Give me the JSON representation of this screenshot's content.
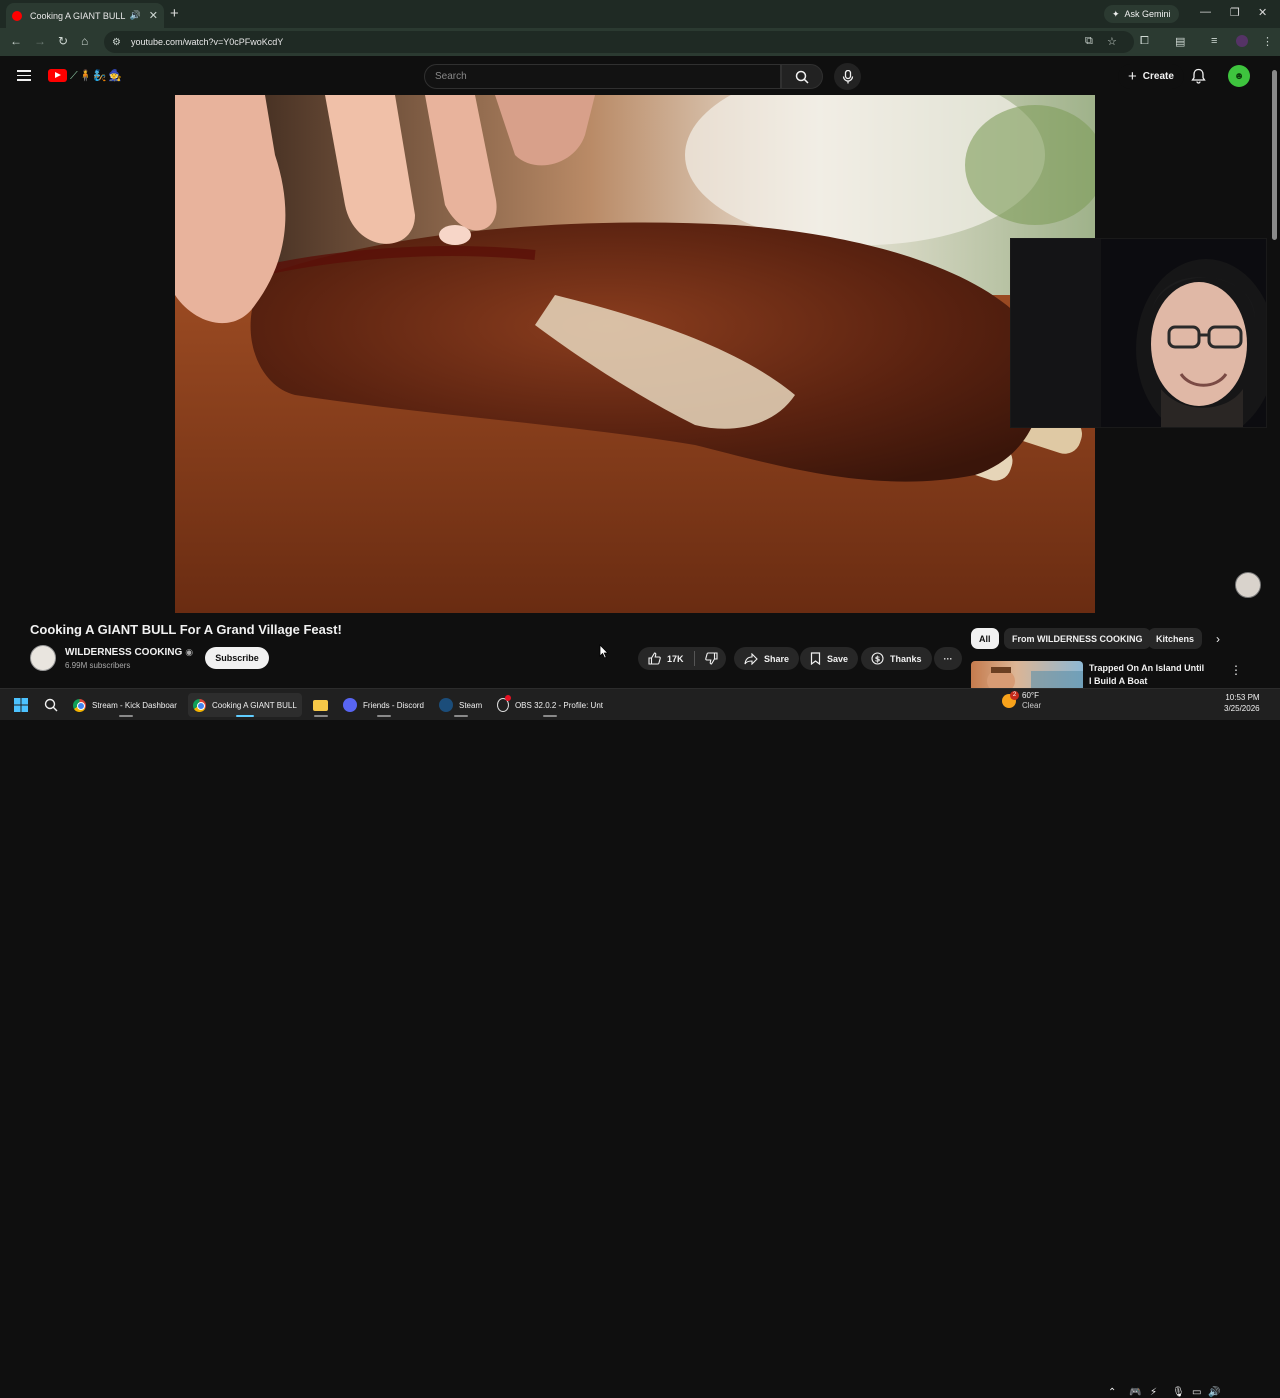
{
  "browser": {
    "tab_title": "Cooking A GIANT BULL For",
    "new_tab_symbol": "+",
    "ask_gemini": "Ask Gemini",
    "url": "youtube.com/watch?v=Y0cPFwoKcdY"
  },
  "youtube": {
    "doodle_text": "⟋🧍🧞🧙",
    "search_placeholder": "Search",
    "create_label": "Create",
    "avatar_glyph": "☻"
  },
  "video": {
    "title": "Cooking A GIANT BULL For A Grand Village Feast!",
    "channel_name": "WILDERNESS COOKING",
    "subscribers": "6.99M subscribers",
    "subscribe_label": "Subscribe",
    "like_count": "17K",
    "share_label": "Share",
    "save_label": "Save",
    "thanks_label": "Thanks",
    "more_label": "···"
  },
  "sidebar": {
    "chips": [
      "All",
      "From WILDERNESS COOKING",
      "Kitchens"
    ],
    "recommended": [
      {
        "title": "Trapped On An Island Until I Build A Boat"
      }
    ]
  },
  "taskbar": {
    "items": [
      {
        "label": "Stream - Kick Dashboar"
      },
      {
        "label": "Cooking A GIANT BULL"
      },
      {
        "label": "Friends - Discord"
      },
      {
        "label": "Steam"
      },
      {
        "label": "OBS 32.0.2 - Profile: Unt"
      }
    ],
    "weather_temp": "60°F",
    "weather_desc": "Clear",
    "weather_badge": "2",
    "time": "10:53 PM",
    "date": "3/25/2026"
  },
  "colors": {
    "accent_red": "#ff0000",
    "background": "#0f0f0f",
    "chip_active": "#f1f1f1"
  },
  "icons": {
    "video_watermark": "channel-watermark-icon",
    "avatar": "alien-avatar-icon"
  }
}
